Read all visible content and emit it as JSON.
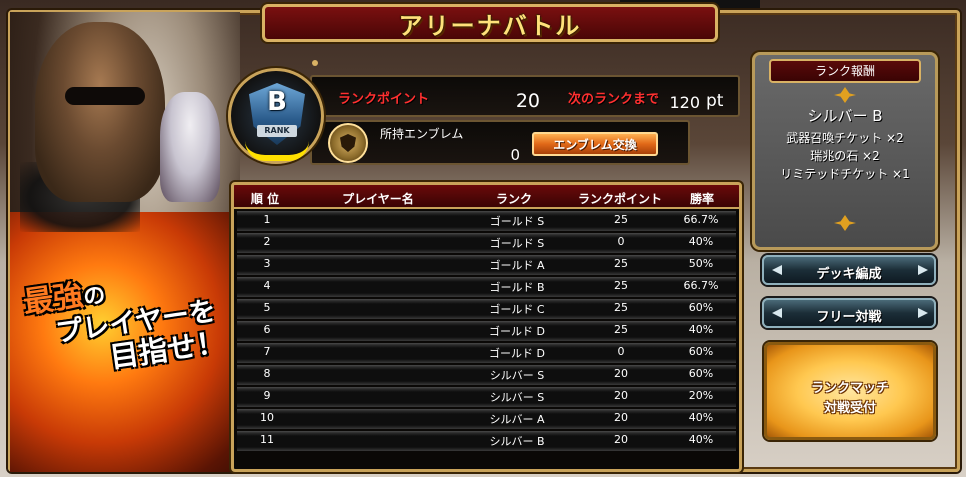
{
  "screen": {
    "title": "アリーナバトル"
  },
  "artwork": {
    "slogan_line1_main": "最強",
    "slogan_line1_suffix": "の",
    "slogan_line2": "プレイヤーを",
    "slogan_line3": "目指せ！"
  },
  "rank_status": {
    "badge_letter": "B",
    "badge_text": "RANK",
    "rank_point_label": "ランクポイント",
    "rank_point_value": "20",
    "next_rank_label": "次のランクまで",
    "next_rank_value": "120",
    "next_rank_unit": "pt",
    "emblem_label": "所持エンブレム",
    "emblem_value": "0",
    "emblem_exchange_button": "エンブレム交換"
  },
  "ranking_table": {
    "headers": [
      "順 位",
      "プレイヤー名",
      "ランク",
      "ランクポイント",
      "勝率"
    ],
    "rows": [
      {
        "pos": "1",
        "name": "",
        "rank": "ゴールド S",
        "points": "25",
        "win_rate": "66.7%"
      },
      {
        "pos": "2",
        "name": "",
        "rank": "ゴールド S",
        "points": "0",
        "win_rate": "40%"
      },
      {
        "pos": "3",
        "name": "",
        "rank": "ゴールド A",
        "points": "25",
        "win_rate": "50%"
      },
      {
        "pos": "4",
        "name": "",
        "rank": "ゴールド B",
        "points": "25",
        "win_rate": "66.7%"
      },
      {
        "pos": "5",
        "name": "",
        "rank": "ゴールド C",
        "points": "25",
        "win_rate": "60%"
      },
      {
        "pos": "6",
        "name": "",
        "rank": "ゴールド D",
        "points": "25",
        "win_rate": "40%"
      },
      {
        "pos": "7",
        "name": "",
        "rank": "ゴールド D",
        "points": "0",
        "win_rate": "60%"
      },
      {
        "pos": "8",
        "name": "",
        "rank": "シルバー S",
        "points": "20",
        "win_rate": "60%"
      },
      {
        "pos": "9",
        "name": "",
        "rank": "シルバー S",
        "points": "20",
        "win_rate": "20%"
      },
      {
        "pos": "10",
        "name": "",
        "rank": "シルバー A",
        "points": "20",
        "win_rate": "40%"
      },
      {
        "pos": "11",
        "name": "",
        "rank": "シルバー B",
        "points": "20",
        "win_rate": "40%"
      }
    ]
  },
  "rank_reward": {
    "title": "ランク報酬",
    "rank": "シルバー B",
    "items": [
      "武器召喚チケット ×2",
      "瑞兆の石 ×2",
      "リミテッドチケット ×1"
    ]
  },
  "buttons": {
    "deck": "デッキ編成",
    "free_battle": "フリー対戦",
    "rank_match_line1": "ランクマッチ",
    "rank_match_line2": "対戦受付"
  },
  "colors": {
    "frame_gold": "#c9a35a",
    "title_text": "#ffe27a",
    "label_red": "#ff3030",
    "button_orange": "#e06818",
    "rank_match_gold": "#ffc850"
  }
}
